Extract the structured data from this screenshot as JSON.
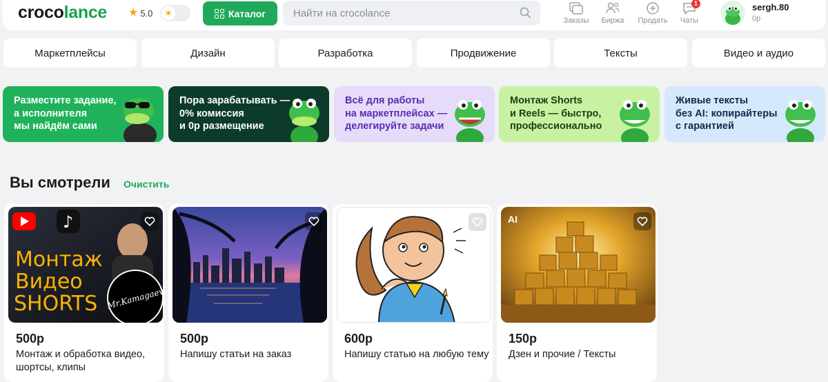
{
  "header": {
    "logo_part1": "croco",
    "logo_part2": "lance",
    "rating": "5.0",
    "catalog_label": "Каталог",
    "search_placeholder": "Найти на crocolance",
    "nav": [
      {
        "label": "Заказы",
        "icon": "orders-icon"
      },
      {
        "label": "Биржа",
        "icon": "exchange-icon"
      },
      {
        "label": "Продать",
        "icon": "sell-icon"
      },
      {
        "label": "Чаты",
        "icon": "chat-icon",
        "badge": "1"
      }
    ],
    "user": {
      "name": "sergh.80",
      "balance": "0р"
    }
  },
  "categories": [
    "Маркетплейсы",
    "Дизайн",
    "Разработка",
    "Продвижение",
    "Тексты",
    "Видео и аудио"
  ],
  "promos": [
    {
      "text": "Разместите задание,\nа исполнителя\nмы найдём сами",
      "bg": "#1fb25a",
      "color": "#ffffff"
    },
    {
      "text": "Пора зарабатывать —\n0% комиссия\nи 0р размещение",
      "bg": "#0d3b2a",
      "color": "#ffffff"
    },
    {
      "text": "Всё для работы\nна маркетплейсах —\nделегируйте задачи",
      "bg": "#e6dcfa",
      "color": "#5b2bb3"
    },
    {
      "text": "Монтаж Shorts\nи Reels — быстро,\nпрофессионально",
      "bg": "#c8f2a2",
      "color": "#1f3d12"
    },
    {
      "text": "Живые тексты\nбез AI: копирайтеры\nс гарантией",
      "bg": "#d6e9fc",
      "color": "#12284a"
    }
  ],
  "recent": {
    "title": "Вы смотрели",
    "clear_label": "Очистить",
    "cards": [
      {
        "price": "500р",
        "title": "Монтаж и обработка видео, шортсы, клипы",
        "img_words": [
          "Монтаж",
          "Видео",
          "SHORTS"
        ],
        "signature": "Mr.Kamagaev"
      },
      {
        "price": "500р",
        "title": "Напишу статьи на заказ"
      },
      {
        "price": "600р",
        "title": "Напишу статью на любую тему"
      },
      {
        "price": "150р",
        "title": "Дзен и прочие / Тексты",
        "tag": "AI"
      }
    ]
  }
}
